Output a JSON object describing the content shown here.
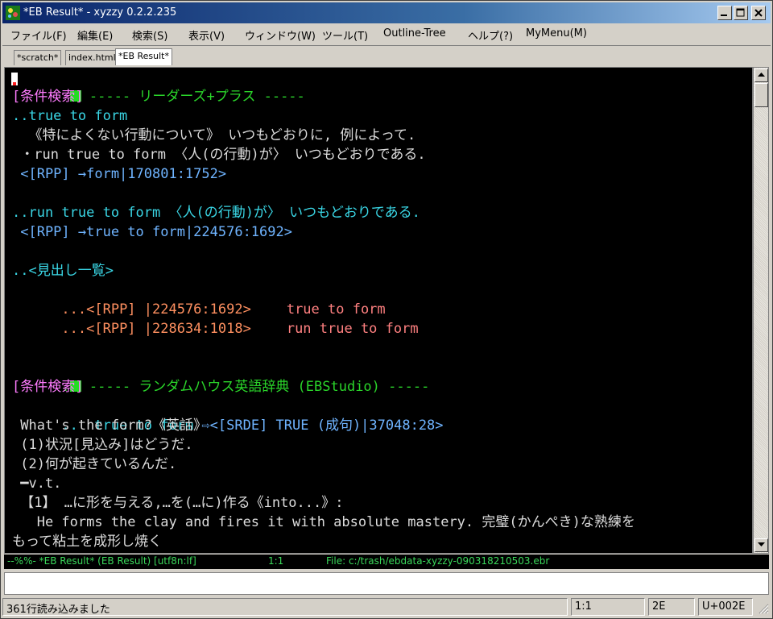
{
  "window": {
    "title": "*EB Result* - xyzzy 0.2.2.235"
  },
  "menu": [
    "ファイル(F)",
    "編集(E)",
    "検索(S)",
    "表示(V)",
    "ウィンドウ(W)",
    "ツール(T)",
    "Outline-Tree",
    "ヘルプ(?)",
    "MyMenu(M)"
  ],
  "tabs": [
    "*scratch*",
    "index.html",
    "*EB Result*"
  ],
  "editor": {
    "l01_marker": ".",
    "l01_title": " ----- リーダーズ+プラス -----",
    "l02": "[条件検索]",
    "l03": "..true to form",
    "l04": "  《特によくない行動について》 いつもどおりに, 例によって.",
    "l05": " ・run true to form 〈人(の行動)が〉 いつもどおりである.",
    "l06": " <[RPP] →form|170801:1752>",
    "l08": "..run true to form 〈人(の行動)が〉 いつもどおりである.",
    "l09": " <[RPP] →true to form|224576:1692>",
    "l11": "..<見出し一覧>",
    "l12_ref": "...<[RPP] |224576:1692>",
    "l12_head": "true to form",
    "l13_ref": "...<[RPP] |228634:1018>",
    "l13_head": "run true to form",
    "l17_marker": ".",
    "l17_title": " ----- ランダムハウス英語辞典 (EBStudio) -----",
    "l18": "[条件検索]",
    "l19_head": "..  true to form ",
    "l19_ref": "⇨<[SRDE] TRUE (成句)|37048:28>",
    "l20": " What's the form?《英話》",
    "l21": " (1)状況[見込み]はどうだ.",
    "l22": " (2)何が起きているんだ.",
    "l23": " ━v.t.",
    "l24": " 【1】 …に形を与える,…を(…に)作る《into...》:",
    "l25": "   He forms the clay and fires it with absolute mastery. 完璧(かんぺき)な熟練を",
    "l26": "もって粘土を成形し焼く"
  },
  "modeline": {
    "left": "--%%- *EB Result* (EB Result) [utf8n:lf]",
    "pos": "1:1",
    "file": "File: c:/trash/ebdata-xyzzy-090318210503.ebr"
  },
  "status": {
    "message": "361行読み込みました",
    "cursor": "1:1",
    "char_hex": "2E",
    "codepoint": "U+002E"
  }
}
